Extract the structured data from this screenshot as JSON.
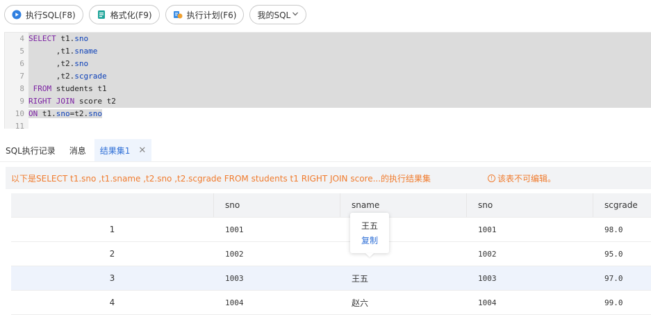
{
  "toolbar": {
    "run_sql": "执行SQL(F8)",
    "format": "格式化(F9)",
    "plan": "执行计划(F6)",
    "my_sql": "我的SQL"
  },
  "editor": {
    "lines": [
      {
        "no": "4"
      },
      {
        "no": "5"
      },
      {
        "no": "6"
      },
      {
        "no": "7"
      },
      {
        "no": "8"
      },
      {
        "no": "9"
      },
      {
        "no": "10"
      },
      {
        "no": "11"
      }
    ],
    "tokens": {
      "l4_kw": "SELECT",
      "l4_a": " t1.",
      "l4_b": "sno",
      "l5_a": "      ,t1.",
      "l5_b": "sname",
      "l6_a": "      ,t2.",
      "l6_b": "sno",
      "l7_a": "      ,t2.",
      "l7_b": "scgrade",
      "l8_kw": " FROM",
      "l8_a": " students t1",
      "l9_kw": "RIGHT JOIN",
      "l9_a": " score t2",
      "l10_kw": "ON",
      "l10_a": " t1.",
      "l10_b": "sno",
      "l10_c": "=t2.",
      "l10_d": "sno"
    }
  },
  "tabs": {
    "history": "SQL执行记录",
    "messages": "消息",
    "result": "结果集1",
    "close": "✕"
  },
  "info": {
    "message": "以下是SELECT t1.sno ,t1.sname ,t2.sno ,t2.scgrade FROM students t1 RIGHT JOIN score...的执行结果集",
    "warn_icon": "!",
    "warning": "该表不可编辑。"
  },
  "table": {
    "headers": [
      "",
      "sno",
      "sname",
      "sno",
      "scgrade"
    ],
    "rows": [
      [
        "1",
        "1001",
        "",
        "1001",
        "98.0"
      ],
      [
        "2",
        "1002",
        "",
        "1002",
        "95.0"
      ],
      [
        "3",
        "1003",
        "王五",
        "1003",
        "97.0"
      ],
      [
        "4",
        "1004",
        "赵六",
        "1004",
        "99.0"
      ]
    ]
  },
  "popover": {
    "value": "王五",
    "copy": "复制"
  },
  "colors": {
    "accent": "#2f6fd6",
    "warning": "#f07b2d",
    "keyword": "#7a1fa2",
    "identifier": "#0b3fb8"
  }
}
